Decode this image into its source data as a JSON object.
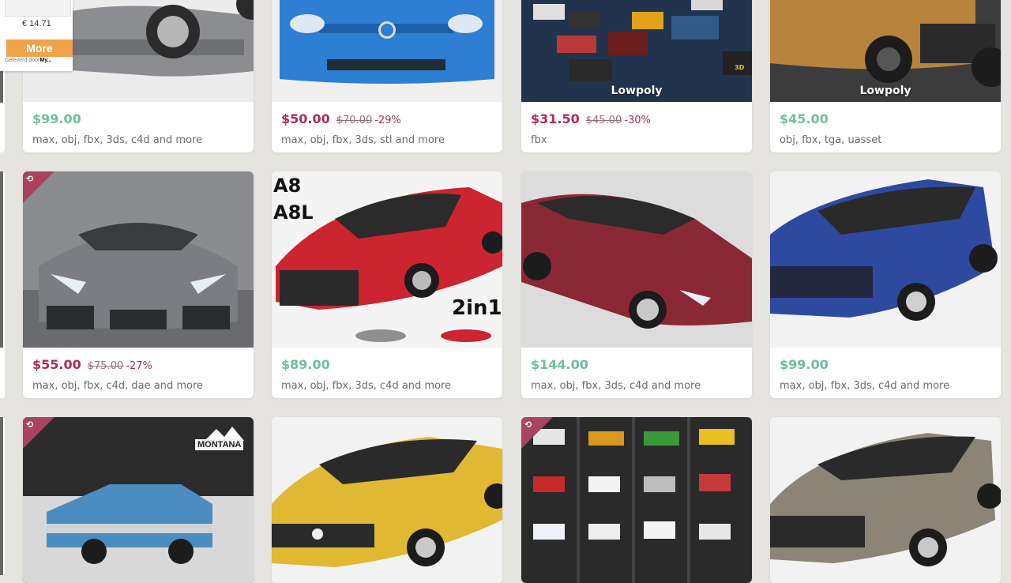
{
  "ad": {
    "price": "€ 14.71",
    "button_label": "More",
    "footer_text": "Geleverd door",
    "footer_brand": "My..."
  },
  "products": [
    {
      "price": "$99.00",
      "on_sale": false,
      "formats": "max, obj, fbx, 3ds, c4d and more",
      "car_color": "#8c8d90",
      "bg": "#e6e6e6"
    },
    {
      "price": "$50.00",
      "on_sale": true,
      "old_price": "$70.00",
      "discount": "-29%",
      "formats": "max, obj, fbx, 3ds, stl and more",
      "car_color": "#2d7fd4",
      "bg": "#efefef"
    },
    {
      "price": "$31.50",
      "on_sale": true,
      "old_price": "$45.00",
      "discount": "-30%",
      "formats": "fbx",
      "overlay": "Lowpoly",
      "car_color": "#b83a3a",
      "bg": "#22344d"
    },
    {
      "price": "$45.00",
      "on_sale": false,
      "formats": "obj, fbx, tga, uasset",
      "overlay": "Lowpoly",
      "car_color": "#b8843d",
      "bg": "#3c3c3c"
    },
    {
      "price": "$55.00",
      "on_sale": true,
      "old_price": "$75.00",
      "discount": "-27%",
      "formats": "max, obj, fbx, c4d, dae and more",
      "car_color": "#7b7d82",
      "bg": "#8b8c90",
      "badge": true
    },
    {
      "price": "$89.00",
      "on_sale": false,
      "formats": "max, obj, fbx, 3ds, c4d and more",
      "car_color": "#cc2430",
      "bg": "#f4f4f4",
      "caption_top": "A8",
      "caption_mid": "A8L",
      "caption_badge": "2in1"
    },
    {
      "price": "$144.00",
      "on_sale": false,
      "formats": "max, obj, fbx, 3ds, c4d and more",
      "car_color": "#8a2836",
      "bg": "#dcdcdc"
    },
    {
      "price": "$99.00",
      "on_sale": false,
      "formats": "max, obj, fbx, 3ds, c4d and more",
      "car_color": "#2d4aa0",
      "bg": "#f2f2f2"
    },
    {
      "car_color": "#4b8dc0",
      "bg": "#2b2b2b",
      "badge": true,
      "brand_text": "MONTANA"
    },
    {
      "car_color": "#e0b832",
      "bg": "#f2f2f2"
    },
    {
      "car_color": "#d9d9d9",
      "bg": "#2a2a2a",
      "badge": true
    },
    {
      "car_color": "#8c8476",
      "bg": "#f2f2f2"
    }
  ]
}
